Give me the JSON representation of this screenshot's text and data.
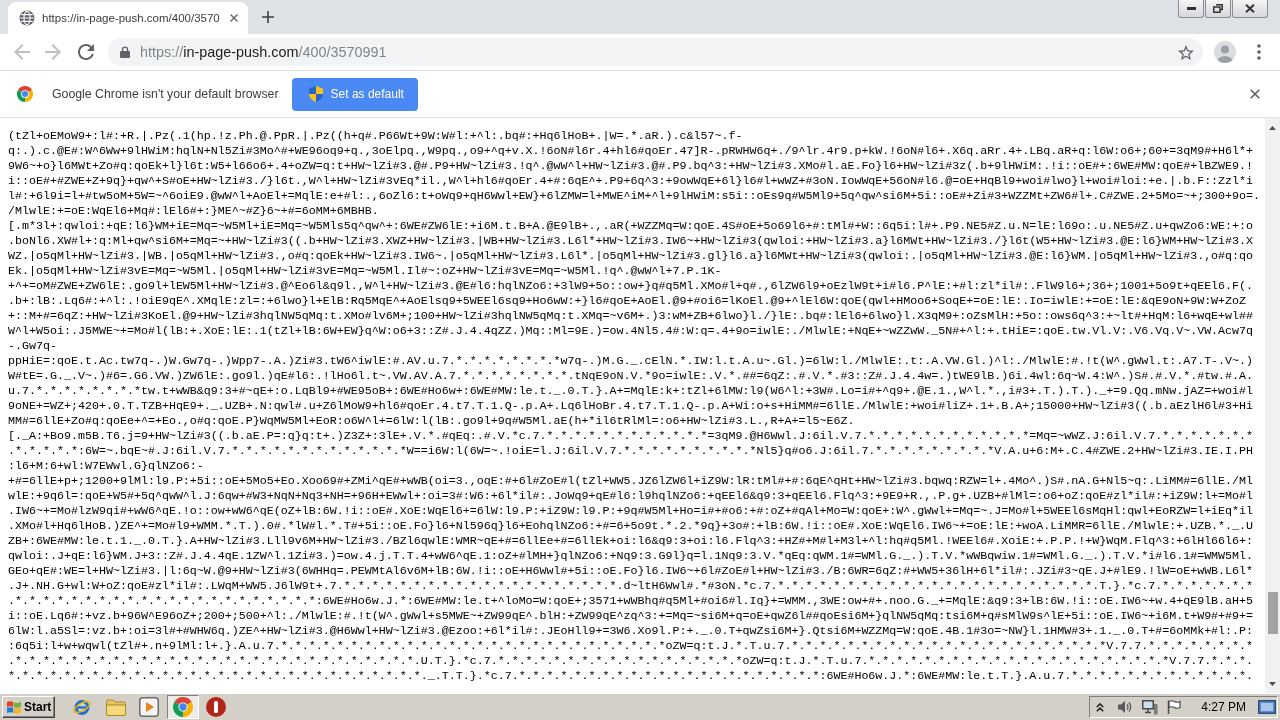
{
  "window": {
    "tabs": [
      {
        "title": "https://in-page-push.com/400/3570",
        "selected": true
      }
    ]
  },
  "toolbar": {
    "navigation": [
      {
        "kind": "back",
        "disabled": true
      },
      {
        "kind": "forward",
        "disabled": true
      },
      {
        "kind": "reload",
        "disabled": false
      }
    ],
    "url": {
      "scheme": "https://",
      "host": "in-page-push.com",
      "path": "/400/3570991"
    }
  },
  "infobar": {
    "message": "Google Chrome isn't your default browser",
    "button": "Set as default"
  },
  "page": {
    "lines": [
      "(tZl+oEMoW9+:l#:+R.|.Pz(.1(hp.!z.Ph.@.PpR.|.Pz((h+q#.P66Wt+9W:W#l:+^l:.bq#:+Hq6lHoB+.|W=.*.aR.).c&l57~.f-",
      "q:.).c.@E#:W^6Ww+9lHWiM:hqlN+Nl5Zi#3Mo^#+WE96oq9+q.,3oElpq.,W9pq.,o9+^q+v.X.!6oN#l6r.4+hl6#qoEr.47]R-.pRWHW6q+./9^lr.4r9.p+kW.!6oN#l6+.X6q.aRr.4+.LBq.aR+q:l6W:o6+;60+=3qM9#+H6l*+",
      "9W6~+o}l6MWt+Zo#q:qoEk+l}l6t:W5+l66o6+.4+oZW=q:t+HW~lZi#3.@#.P9+HW~lZi#3.!q^.@wW^l+HW~lZi#3.@#.P9.bq^3:+HW~lZi#3.XMo#l.aE.Fo}l6+HW~lZi#3z(.b+9lHWiM:.!i::oE#+:6WE#MW:qoE#+lBZWE9.!",
      "i::oE#+#ZWE+Z+9q}+qw^+S#oE+HW~lZi#3./}l6t.,W^l+HW~lZi#3vEq*il.,W^l+hl6#qoEr.4+#:6qE^+.P9+6q^3:+9owWqE+6l}l6#l+wWZ+#3oN.IowWqE+56oN#l6.@=oE+HqBl9+woi#lwo}l+woi#loi:+e.|.b.F::Zzl*i",
      "l#:+6l9i=l+#tw5oM+5W=~^6oiE9.@wW^l+AoEl+=MqlE:e+#l:.,6oZl6:t+oWq9+qH6Wwl+EW}+6lZMW=l+MWE^iM+^l+9lHWiM:s5i::oEs9q#W5Ml9+5q^qw^si6M+5i::oE#+Zi#3+WZZMt+ZW6#l+.C#ZWE.2+5Mo=~+;300+9o=.",
      "/MlwlE:+=oE:WqEl6+Mq#:lEl6#+:}ME^~#Z}6~+#=6oMM+6MBHB.",
      "[.m*3l+:qwloi:+qE:l6}WM+iE=Mq=~W5Ml+iE=Mq=~W5Mls5q^qw^+:6WE#ZW6lE:+i6M.t.B+A.@E9lB+.,.aR(+WZZMq=W:qoE.4S#oE+5o69l6+#:tMl#+W::6q5i:l#+.P9.NE5#Z.u.N=lE:l69o:.u.NE5#Z.u+qwZo6:WE:+:o",
      ".boNl6.XW#l+:q:Ml+qw^si6M+=Mq=~+HW~lZi#3((.b+HW~lZi#3.XWZ+HW~lZi#3.|WB+HW~lZi#3.L6l*+HW~lZi#3.IW6~+HW~lZi#3(qwloi:+HW~lZi#3.a}l6MWt+HW~lZi#3./}l6t(W5+HW~lZi#3.@E:l6}WM+HW~lZi#3.X",
      "WZ.|o5qMl+HW~lZi#3.|WB.|o5qMl+HW~lZi#3.,o#q:qoEk+HW~lZi#3.IW6~.|o5qMl+HW~lZi#3.L6l*.|o5qMl+HW~lZi#3.gl}l6.a}l6MWt+HW~lZi#3(qwloi:.|o5qMl+HW~lZi#3.@E:l6}WM.|o5qMl+HW~lZi#3.,o#q:qo",
      "Ek.|o5qMl+HW~lZi#3vE=Mq=~W5Ml.|o5qMl+HW~lZi#3vE=Mq=~W5Ml.Il#~:oZ+HW~lZi#3vE=Mq=~W5Ml.!q^.@wW^l+7.P.1K-",
      "+^+=oM#ZWE+ZW6lE:.go9l+lEW5Ml+HW~lZi#3.@^Eo6l&q9l.,W^l+HW~lZi#3.@E#l6:hqlNZo6:+3lW9+5o::ow+}q#q5Ml.XMo#l+q#.,6lZW6l9+oEzlW9t+i#l6.P^lE:+#l:zl*il#:.FlW9l6+;36+;1001+5o9t+qEEl6.F(.",
      ".b+:lB:.Lq6#:+^l:.!oiE9qE^.XMqlE:zl=:+6lwo}l+ElB:Rq5MqE^+AoElsq9+5WEEl6sq9+Ho6wW:+}l6#qoE+AoEl.@9+#oi6=lKoEl.@9+^lEl6W:qoE(qwl+HMoo6+SoqE+=oE:lE:.Io=iwlE:+=oE:lE:&qE9oN+9W:W+ZoZ",
      "+::M+#=6qZ:+HW~lZi#3KoEl.@9+HW~lZi#3hqlNW5qMq:t.XMo#lv6M+;100+HW~lZi#3hqlNW5qMq:t.XMq=~v6M+.)3:wM+ZB+6lwo}l./}lE:.bq#:lEl6+6lwo}l.X3qM9+:oZsMlH:+5o::ows6q^3:+~lt#+HqM:l6+wqE+wl##",
      "W^l+W5oi:.J5MWE~+=Mo#l(lB:+.XoE:lE:.1(tZl+lB:6W+EW}q^W:o6+3::Z#.J.4.4qZZ.)Mq::Ml=9E.)=ow.4Nl5.4#:W:q=.4+9o=iwlE:./MlwlE:+NqE+~wZZwW._5N#+^l:+.tHiE=:qoE.tw.Vl.V:.V6.Vq.V~.VW.Acw7q",
      "-.Gw7q-",
      "ppHiE=:qoE.t.Ac.tw7q-.)W.Gw7q-.)Wpp7-.A.)Zi#3.tW6^iwlE:#.AV.u.7.*.*.*.*.*.*.*.*w7q-.)M.G._.cElN.*.IW:l.t.A.u~.Gl.)=6lW:l./MlwlE:.t:.A.VW.Gl.)^l:./MlwlE:#.!t(W^.gWwl.t:.A7.T-.V~.)",
      "W#tE=.G._.V~.)#6=.G6.VW.)ZW6lE:.go9l.)qE#l6:.!lHo6l.t~.VW.AV.A.7.*.*.*.*.*.*.*.*.tNqE9oN.V.*9o=iwlE:.V.*.##=6qZ:.#.V.*.#3::Z#.J.4.4w=.)tWE9lB.)6i.4wl:6q~W.4:W^.)S#.#.V.*.#tw.#.A.",
      "u.7.*.*.*.*.*.*.*.*tw.t+wWB&q9:3+#~qE+:o.LqBl9+#WE95oB+:6WE#Ho6w+:6WE#MW:le.t._.0.T.}.A+=MqlE:k+:tZl+6lMW:l9(W6^l:+3W#.Lo=i#+^q9+.@E.1.,W^l.*.,i#3+.T.).T.)._+=9.Qq.mNw.jAZ=+woi#l",
      "9oNE+=WZ+;420+.0.T.TZB+HqE9+._.UZB+.N:qwl#.u+Z6lMoW9+hl6#qoEr.4.t7.T.1.Q-.p.A+.Lq6lHoBr.4.t7.T.1.Q-.p.A+Wi:o+s+HiMM#=6llE./MlwlE:+woi#liZ+.1+.B.A+;15000+HW~lZi#3((.b.aEzlH6l#3+Hi",
      "MM#=6llE+Zo#q:qoEe+^=+Eo.,o#q:qoE.P}WqMW5Ml+EoR:o6W^l+=6lW:l(lB:.go9l+9q#W5Ml.aE(h+*il6tRlMl=:o6+HW~lZi#3.L.,R+A+=l5~E6Z.",
      "[._A:+Bo9.m5B.T6.j=9+HW~lZi#3((.b.aE.P=:q}q:t+.)Z3Z+:3lE+.V.*.#qEq:.#.V.*c.7.*.*.*.*.*.*.*.*.*.*.*.*=3qM9.@H6Wwl.J:6il.V.7.*.*.*.*.*.*.*.*.*.*.*.*=Mq=~wWZ.J:6il.V.7.*.*.*.*.*.*.*",
      ".*.*.*.*.*:6W=~.bqE~#.J:6il.V.7.*.*.*.*.*.*.*.*.*.*.*.*.*W==i6W:l(6W=~.!oiE=l.J:6il.V.7.*.*.*.*.*.*.*.*.*.*Nl5}q#o6.J:6il.7.*.*.*.*.*.*.*.*.*V.A.u+6:M+.C.4#ZWE.2+HW~lZi#3.IE.I.PH",
      ":l6+M:6+wl:W7EWwl.G}qlNZo6:-",
      "+#=6llE+p+;1200+9lMl:l9.P:+5i::oE+5Mo5+Eo.Xoo69#+ZMi^qE#+wWB(oi=3.,oqE:#+6l#ZoE#l(tZl+WW5.JZ6lZW6l+iZ9W:lR:tMl#+#:6qE^qHt+HW~lZi#3.bqwq:RZW=l+.4Mo^.)S#.nA.G+Nl5~q:.LiMM#=6llE./Ml",
      "wlE:+9q6l=:qoE+W5#+5q^qwW^l.J:6qw+#W3+NqN+Nq3+NH=+96H+EWwl+:oi=3#:W6:+6l*il#:.JoWq9+qE#l6:l9hqlNZo6:+qEEl6&q9:3+qEEl6.Flq^3:+9E9+R.,.P.g+.UZB+#lMl=:o6+oZ:qoE#zl*il#:+iZ9W:l+=Mo#l",
      ".IW6~+=Mo#lzW9qi#+wW6^qE.!o::ow+wW6^qE(oZ+lB:6W.!i::oE#.XoE:WqEl6+=6lW:l9.P:+iZ9W:l9.P:+9q#W5Ml+Ho=i#+#o6:+#:oZ+#qAl+Mo=W:qoE+:W^.gWwl+=Mq=~.J=Mo#l+5WEEl6sMqHl:qwl+EoRZW=l+iEq*il",
      ".XMo#l+Hq6lHoB.)ZE^+=Mo#l9+WMM.*.T.).0#.*lW#l.*.T#+5i::oE.Fo}l6+Nl596q}l6+EohqlNZo6:+#=6+5o9t.*.2.*9q}+3o#:+lB:6W.!i::oE#.XoE:WqEl6.IW6~+=oE:lE:+woA.LiMMR=6llE./MlwlE:+.UZB.*._.U",
      "ZB+:6WE#MW:le.t.1._.0.T.}.A+HW~lZi#3.Lll9v6M+HW~lZi#3./BZl6qwlE:WMR~qE+#=6llEe+#=6llEk+oi:l6&q9:3+oi:l6.Flq^3:+HZ#+M#l+M3l+^l:hq#q5Ml.!WEEl6#.XoiE:+.P.P.!+W}WqM.Flq^3:+6lHl66l6+:",
      "qwloi:.J+qE:l6}WM.J+3::Z#.J.4.4qE.1ZW^l.1Zi#3.)=ow.4.j.T.T.4+wW6^qE.1:oZ+#lMH+}qlNZo6:+Nq9:3.G9l}q=l.1Nq9:3.V.*qEq:qWM.1#=WMl.G._.).T.V.*wWBqwiw.1#=WMl.G._.).T.V.*i#l6.1#=WMW5Ml.",
      "GEo+qE#:WE=l+HW~lZi#3.|l:6q~W.@9+HW~lZi#3(6WHHq=.PEWMtAl6v6M+lB:6W.!i::oE+H6Wwl#+5i::oE.Fo}l6.IW6~+6l#ZoE#l+HW~lZi#3./B:6WR=6qZ:#+WW5+36lH+6l*il#:.JZi#3~qE.J+#lE9.!lW=oE+wWB.L6l*",
      ".J+.NH.G+wl:W+oZ:qoE#zl*il#:.LWqM+WW5.J6lW9t+.7.*.*.*.*.*.*.*.*.*.*.*.*.*.*.*.*.*.*.*.*.d~ltH6Wwl#.*#3oN.*c.7.*.*.*.*.*.*.*.*.*.*.*.*.*.*.*.*.*.*.*.*.*.*.*.T.}.*c.7.*.*.*.*.*.*.*",
      ".*.*.*.*.*.*.*.*.*.*.*.*.*.*.*.*.*.*.*.*.*.*:6WE#Ho6w.J.*:6WE#MW:le.t+^loMo=W:qoE+;3571+wWBhq#q5Ml+#oi6#l.Iq}+=WMM.,3WE:ow+#+.noo.G._+=MqlE:&q9:3+lB:6W.!i::oE.IW6~+w.4+qE9lB.aH+5",
      "i::oE.Lq6#:+vz.b+96W^E96oZ+;200+;500+^l:./MlwlE:#.!t(W^.gWwl+s5MWE~+ZW99qE^.blH:+ZW99qE^zq^3:+=Mq=~si6M+q=oE+qwZ6l##qoEsi6M+}qlNW5qMq:tsi6M+q#sMlW9s^lE+5i::oE.IW6~+i6M.t+W9#+#9+=",
      "6lW:l.a5Sl=:vz.b+:oi=3l#+#WHW6q.)ZE^+HW~lZi#3.@H6Wwl+HW~lZi#3.@Ezoo:+6l*il#:.JEoHll9+=3W6.Xo9l.P:+._.0.T+qwZsi6M+}.Qtsi6M+WZZMq=W:qoE.4B.1#3o=~NW}l.1HMW#3+.1._.0.T+#=6oMMk+#l:.P:",
      ":6q5i:l+w+wqwl(tZl#+.n+9lMl:l+.}.A.u.7.*.*.*.*.*.*.*.*.*.*.*.*.*.*.*.*.*.*.*.*.*.*.*.*.*.*.*.*oZW=q:t.J.*.T.u.7.*.*.*.*.*.*.*.*.*.*.*.*.*.*.*.*.*.*.*.*.*.*.*V.7.7.*.*.*.*.*.*.*.*",
      ".*.*.*.*.*.*.*.*.*.*.*.*.*.*.*.*.*.*.*.*.*.*.*.*.*.*.*.*.*.U.T.}.*c.7.*.*.*.*.*.*.*.*.*.*.*.*.*.*.*.*.*.*oZW=q:t.J.*.T.u.7.*.*.*.*.*.*.*.*.*.*.*.*.*.*.*.*.*.*.*.*.*.*V.7.7.*.*.*.",
      "*.*.*.*.*.*.*.*.*.*.*.*.*.*.*.*.*.*.*.*.*.*.*.*.*.*.*.*.*.*._.T.T.}.*c.7.*.*.*.*.*.*.*.*.*.*.*.*.*.*.*.*.*.*.*.*.*.*:6WE#Ho6w.J.*:6WE#MW:le.t.T.}.A.u.7.*.*.*.*.*.*.*.*.*.*.*.*.*."
    ]
  },
  "taskbar": {
    "start": "Start",
    "apps": [
      {
        "kind": "e-logo",
        "selected": false
      },
      {
        "kind": "folder",
        "selected": false
      },
      {
        "kind": "player",
        "selected": false
      },
      {
        "kind": "ring-logo",
        "selected": true
      },
      {
        "kind": "circle-bar",
        "selected": false
      }
    ],
    "clock": "4:27 PM"
  }
}
